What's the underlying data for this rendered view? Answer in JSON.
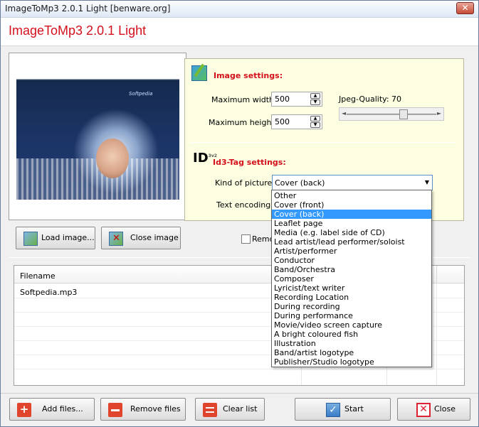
{
  "window": {
    "title": "ImageToMp3 2.0.1 Light [benware.org]",
    "close_glyph": "✕"
  },
  "header": {
    "app_title": "ImageToMp3 2.0.1 Light"
  },
  "preview": {
    "logo_text": "Softpedia"
  },
  "image_settings": {
    "title": "Image settings:",
    "max_width_label": "Maximum width:",
    "max_width_value": "500",
    "max_height_label": "Maximum height:",
    "max_height_value": "500",
    "jpeg_quality_label": "Jpeg-Quality: 70",
    "jpeg_quality_value": 70
  },
  "id3_settings": {
    "title": "Id3-Tag settings:",
    "icon_text": "ID",
    "icon_sub": "3v2",
    "kind_label": "Kind of picture:",
    "kind_value": "Cover (back)",
    "encoding_label": "Text encoding:"
  },
  "picture_types": [
    "Other",
    "Cover (front)",
    "Cover (back)",
    "Leaflet page",
    "Media (e.g. label side of CD)",
    "Lead artist/lead performer/soloist",
    "Artist/performer",
    "Conductor",
    "Band/Orchestra",
    "Composer",
    "Lyricist/text writer",
    "Recording Location",
    "During recording",
    "During performance",
    "Movie/video screen capture",
    "A bright coloured fish",
    "Illustration",
    "Band/artist logotype",
    "Publisher/Studio logotype"
  ],
  "selected_picture_type_index": 2,
  "image_buttons": {
    "load": "Load image...",
    "close": "Close image"
  },
  "remove_checkbox_label": "Remo",
  "file_list": {
    "header_filename": "Filename",
    "rows": [
      "Softpedia.mp3"
    ]
  },
  "bottom_buttons": {
    "add": "Add files...",
    "remove": "Remove files",
    "clear": "Clear list",
    "start": "Start",
    "close": "Close"
  },
  "colors": {
    "accent_red": "#d4101c",
    "selection_blue": "#3399ff",
    "settings_bg": "#fdfde2"
  }
}
